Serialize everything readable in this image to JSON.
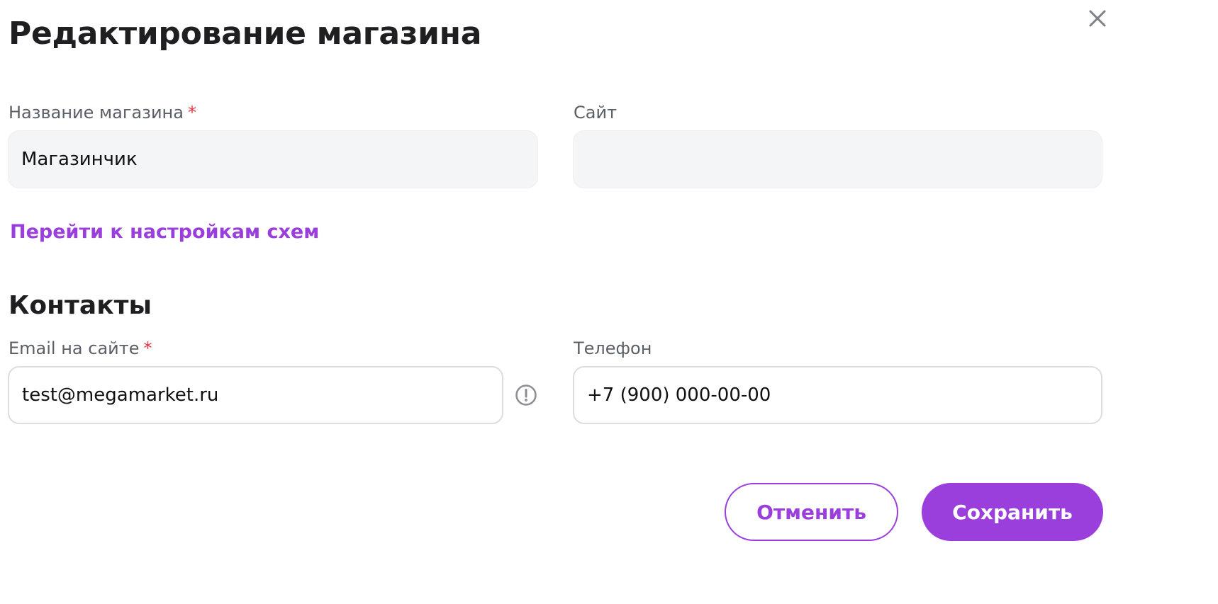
{
  "dialog": {
    "title": "Редактирование магазина"
  },
  "fields": {
    "store_name": {
      "label": "Название магазина",
      "required_mark": "*",
      "value": "Магазинчик"
    },
    "site": {
      "label": "Сайт",
      "value": ""
    }
  },
  "links": {
    "schemes_settings": "Перейти к настройкам схем"
  },
  "contacts": {
    "title": "Контакты",
    "email": {
      "label": "Email на сайте",
      "required_mark": "*",
      "value": "test@megamarket.ru",
      "hint_icon": "info-circle-icon"
    },
    "phone": {
      "label": "Телефон",
      "value": "+7 (900) 000-00-00"
    }
  },
  "buttons": {
    "cancel": "Отменить",
    "save": "Сохранить"
  },
  "icons": {
    "close": "close-icon",
    "info": "info-circle-icon"
  },
  "colors": {
    "accent": "#9b3fdc",
    "required": "#e8343f",
    "input_fill": "#f4f5f7",
    "input_border": "#dcdde1",
    "text_primary": "#1f1f22",
    "label": "#5b5f66"
  }
}
